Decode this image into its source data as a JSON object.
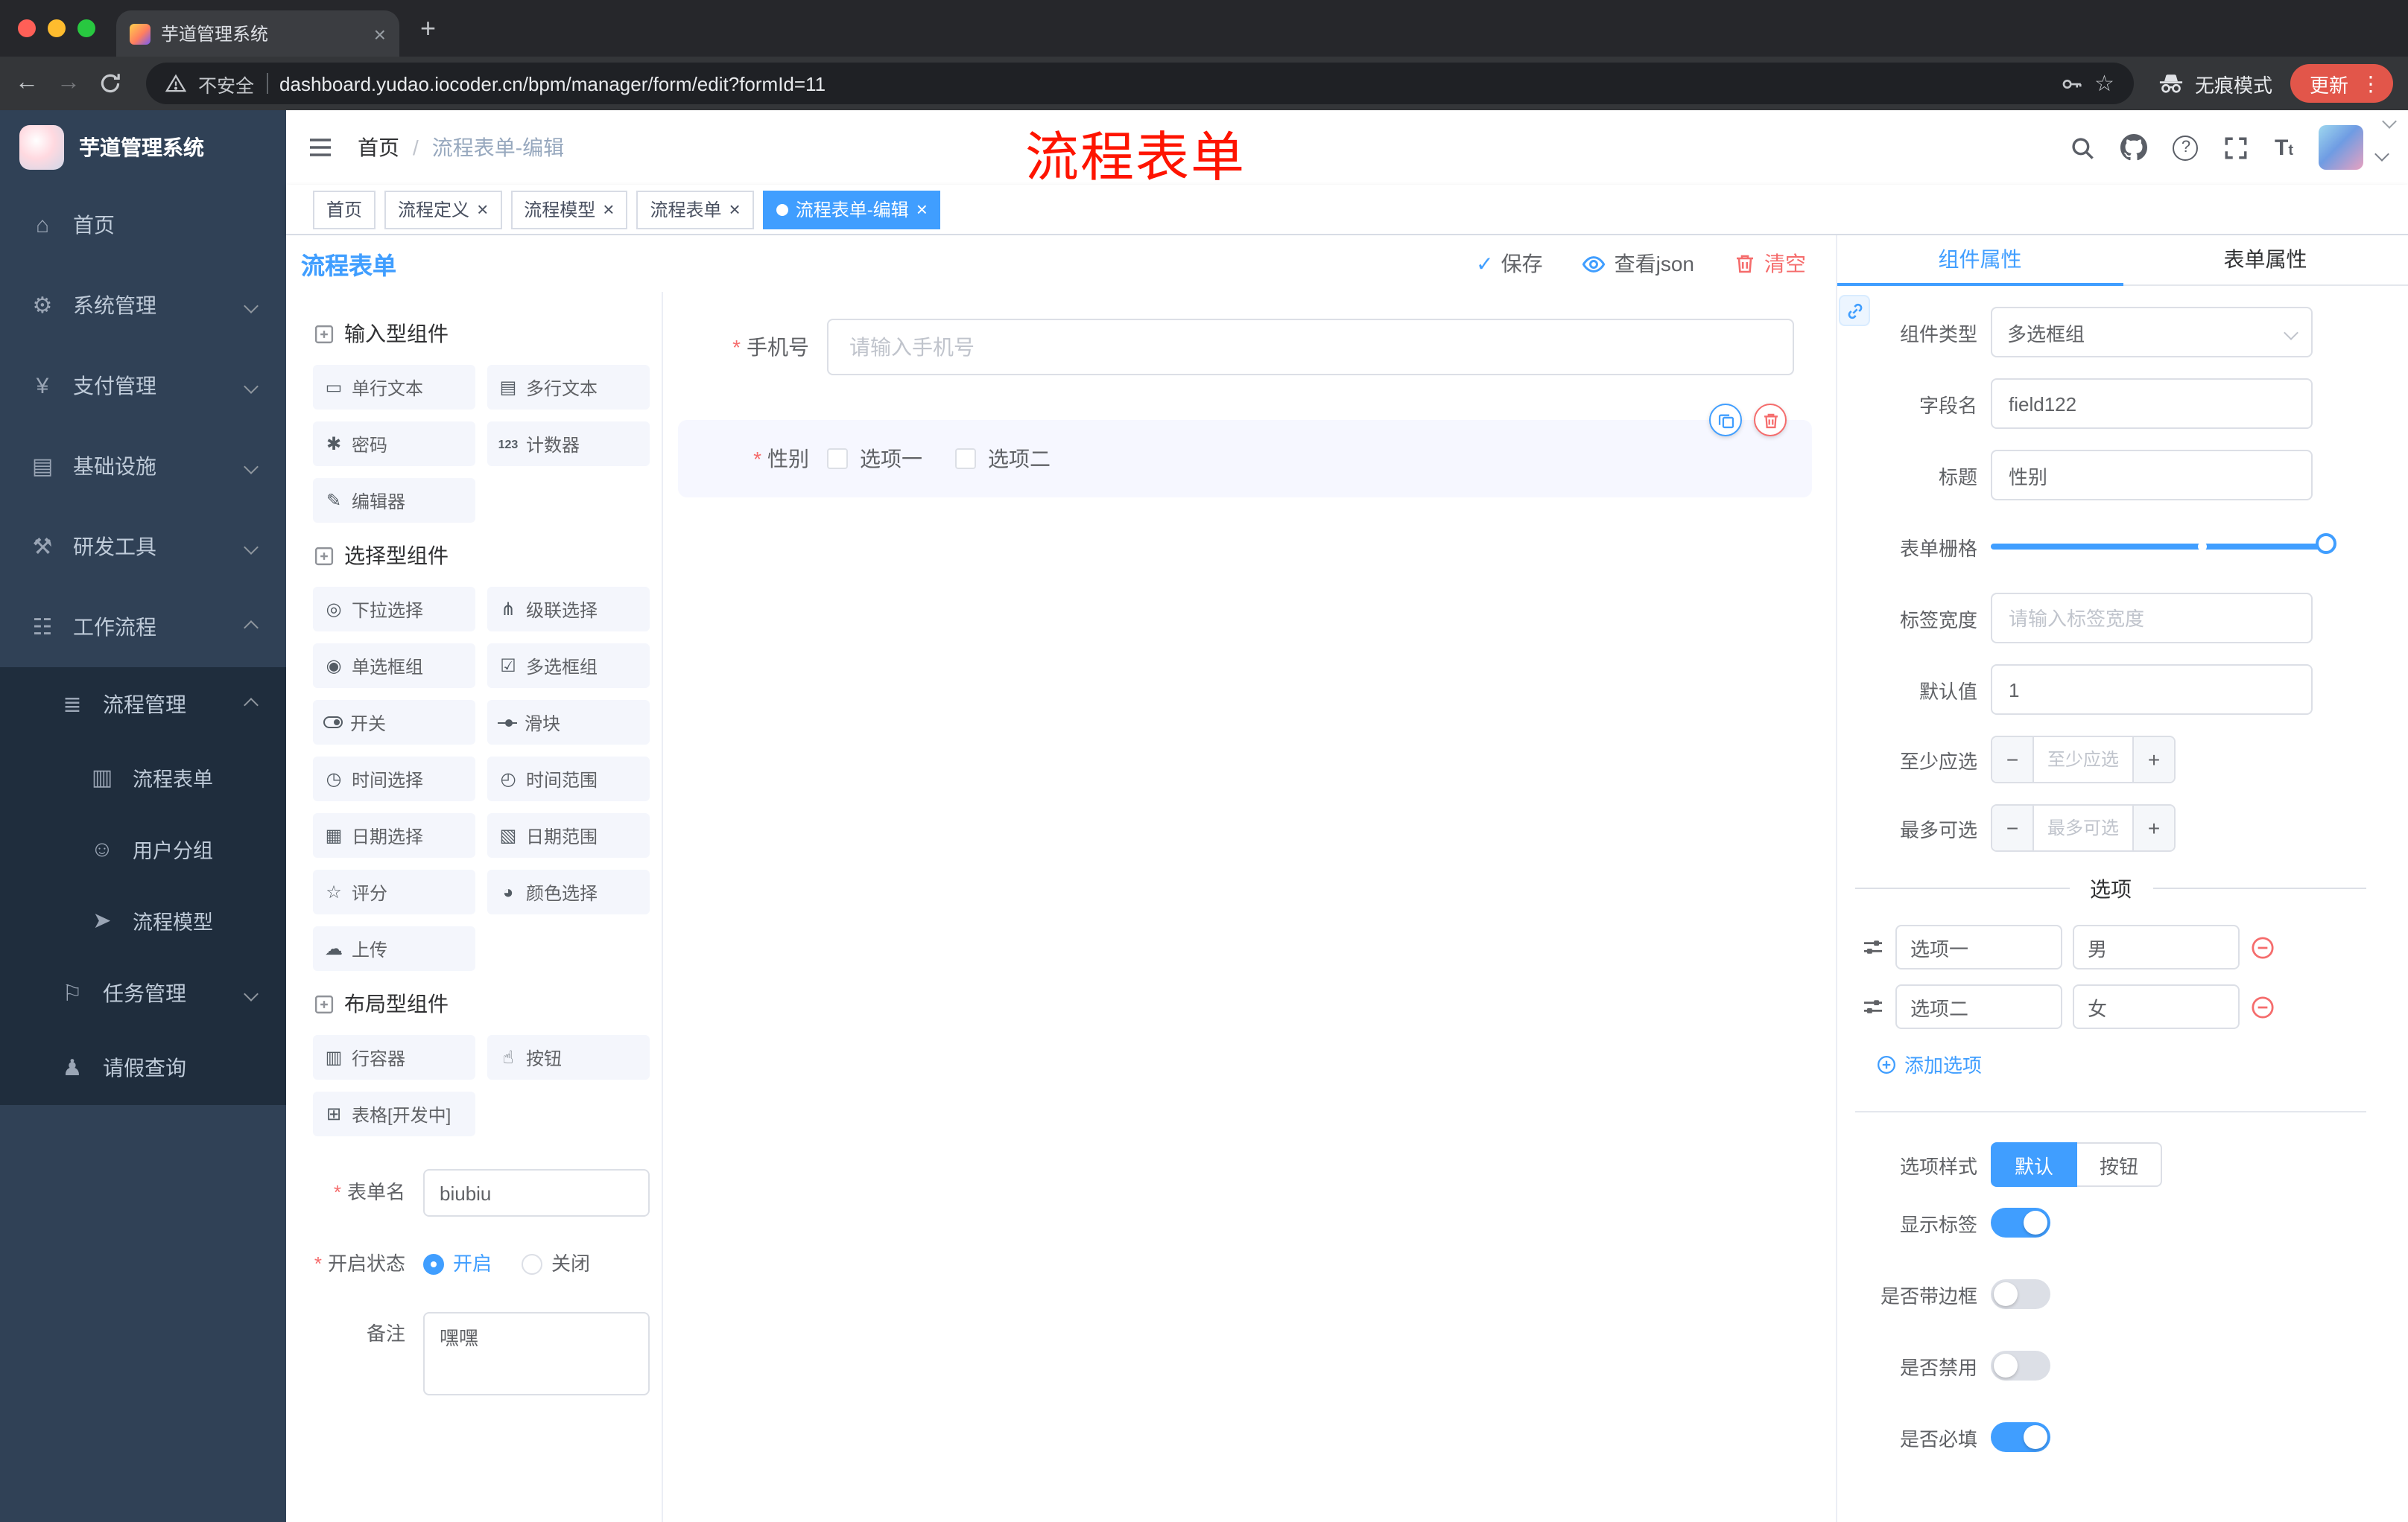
{
  "browser": {
    "tab_title": "芋道管理系统",
    "security_label": "不安全",
    "url": "dashboard.yudao.iocoder.cn/bpm/manager/form/edit?formId=11",
    "incognito_label": "无痕模式",
    "update_label": "更新"
  },
  "annotation": "流程表单",
  "sidebar": {
    "logo_title": "芋道管理系统",
    "home": "首页",
    "system": "系统管理",
    "payment": "支付管理",
    "infra": "基础设施",
    "devtools": "研发工具",
    "workflow": "工作流程",
    "process_mgmt": "流程管理",
    "process_form": "流程表单",
    "user_group": "用户分组",
    "process_model": "流程模型",
    "task_mgmt": "任务管理",
    "leave_query": "请假查询"
  },
  "header": {
    "breadcrumb_home": "首页",
    "breadcrumb_current": "流程表单-编辑"
  },
  "tags": [
    {
      "label": "首页",
      "active": false,
      "closable": false
    },
    {
      "label": "流程定义",
      "active": false,
      "closable": true
    },
    {
      "label": "流程模型",
      "active": false,
      "closable": true
    },
    {
      "label": "流程表单",
      "active": false,
      "closable": true
    },
    {
      "label": "流程表单-编辑",
      "active": true,
      "closable": true
    }
  ],
  "designer": {
    "title": "流程表单",
    "save": "保存",
    "view_json": "查看json",
    "clear": "清空"
  },
  "components": {
    "section_input": "输入型组件",
    "section_select": "选择型组件",
    "section_layout": "布局型组件",
    "input_items": [
      "单行文本",
      "多行文本",
      "密码",
      "计数器",
      "编辑器"
    ],
    "select_items": [
      "下拉选择",
      "级联选择",
      "单选框组",
      "多选框组",
      "开关",
      "滑块",
      "时间选择",
      "时间范围",
      "日期选择",
      "日期范围",
      "评分",
      "颜色选择",
      "上传"
    ],
    "layout_items": [
      "行容器",
      "按钮",
      "表格[开发中]"
    ]
  },
  "form_meta": {
    "name_label": "表单名",
    "name_value": "biubiu",
    "status_label": "开启状态",
    "status_on": "开启",
    "status_off": "关闭",
    "status_selected": "开启",
    "remark_label": "备注",
    "remark_value": "嘿嘿"
  },
  "canvas": {
    "phone_label": "手机号",
    "phone_placeholder": "请输入手机号",
    "gender_label": "性别",
    "gender_opt1": "选项一",
    "gender_opt2": "选项二",
    "gender_selected": true
  },
  "props": {
    "tab_component": "组件属性",
    "tab_form": "表单属性",
    "type_label": "组件类型",
    "type_value": "多选框组",
    "field_label": "字段名",
    "field_value": "field122",
    "title_label": "标题",
    "title_value": "性别",
    "grid_label": "表单栅格",
    "label_width_label": "标签宽度",
    "label_width_placeholder": "请输入标签宽度",
    "default_label": "默认值",
    "default_value": "1",
    "min_label": "至少应选",
    "min_placeholder": "至少应选",
    "max_label": "最多可选",
    "max_placeholder": "最多可选",
    "options_title": "选项",
    "opt1_label": "选项一",
    "opt1_value": "男",
    "opt2_label": "选项二",
    "opt2_value": "女",
    "add_option": "添加选项",
    "style_label": "选项样式",
    "style_default": "默认",
    "style_button": "按钮",
    "switch_show_label": "显示标签",
    "switch_border": "是否带边框",
    "switch_disabled": "是否禁用",
    "switch_required": "是否必填",
    "switch_states": {
      "show_label": true,
      "border": false,
      "disabled": false,
      "required": true
    }
  },
  "colors": {
    "accent": "#409eff",
    "danger": "#f56c6c",
    "annotation": "#fe1400",
    "tag_active": "#409eff"
  }
}
